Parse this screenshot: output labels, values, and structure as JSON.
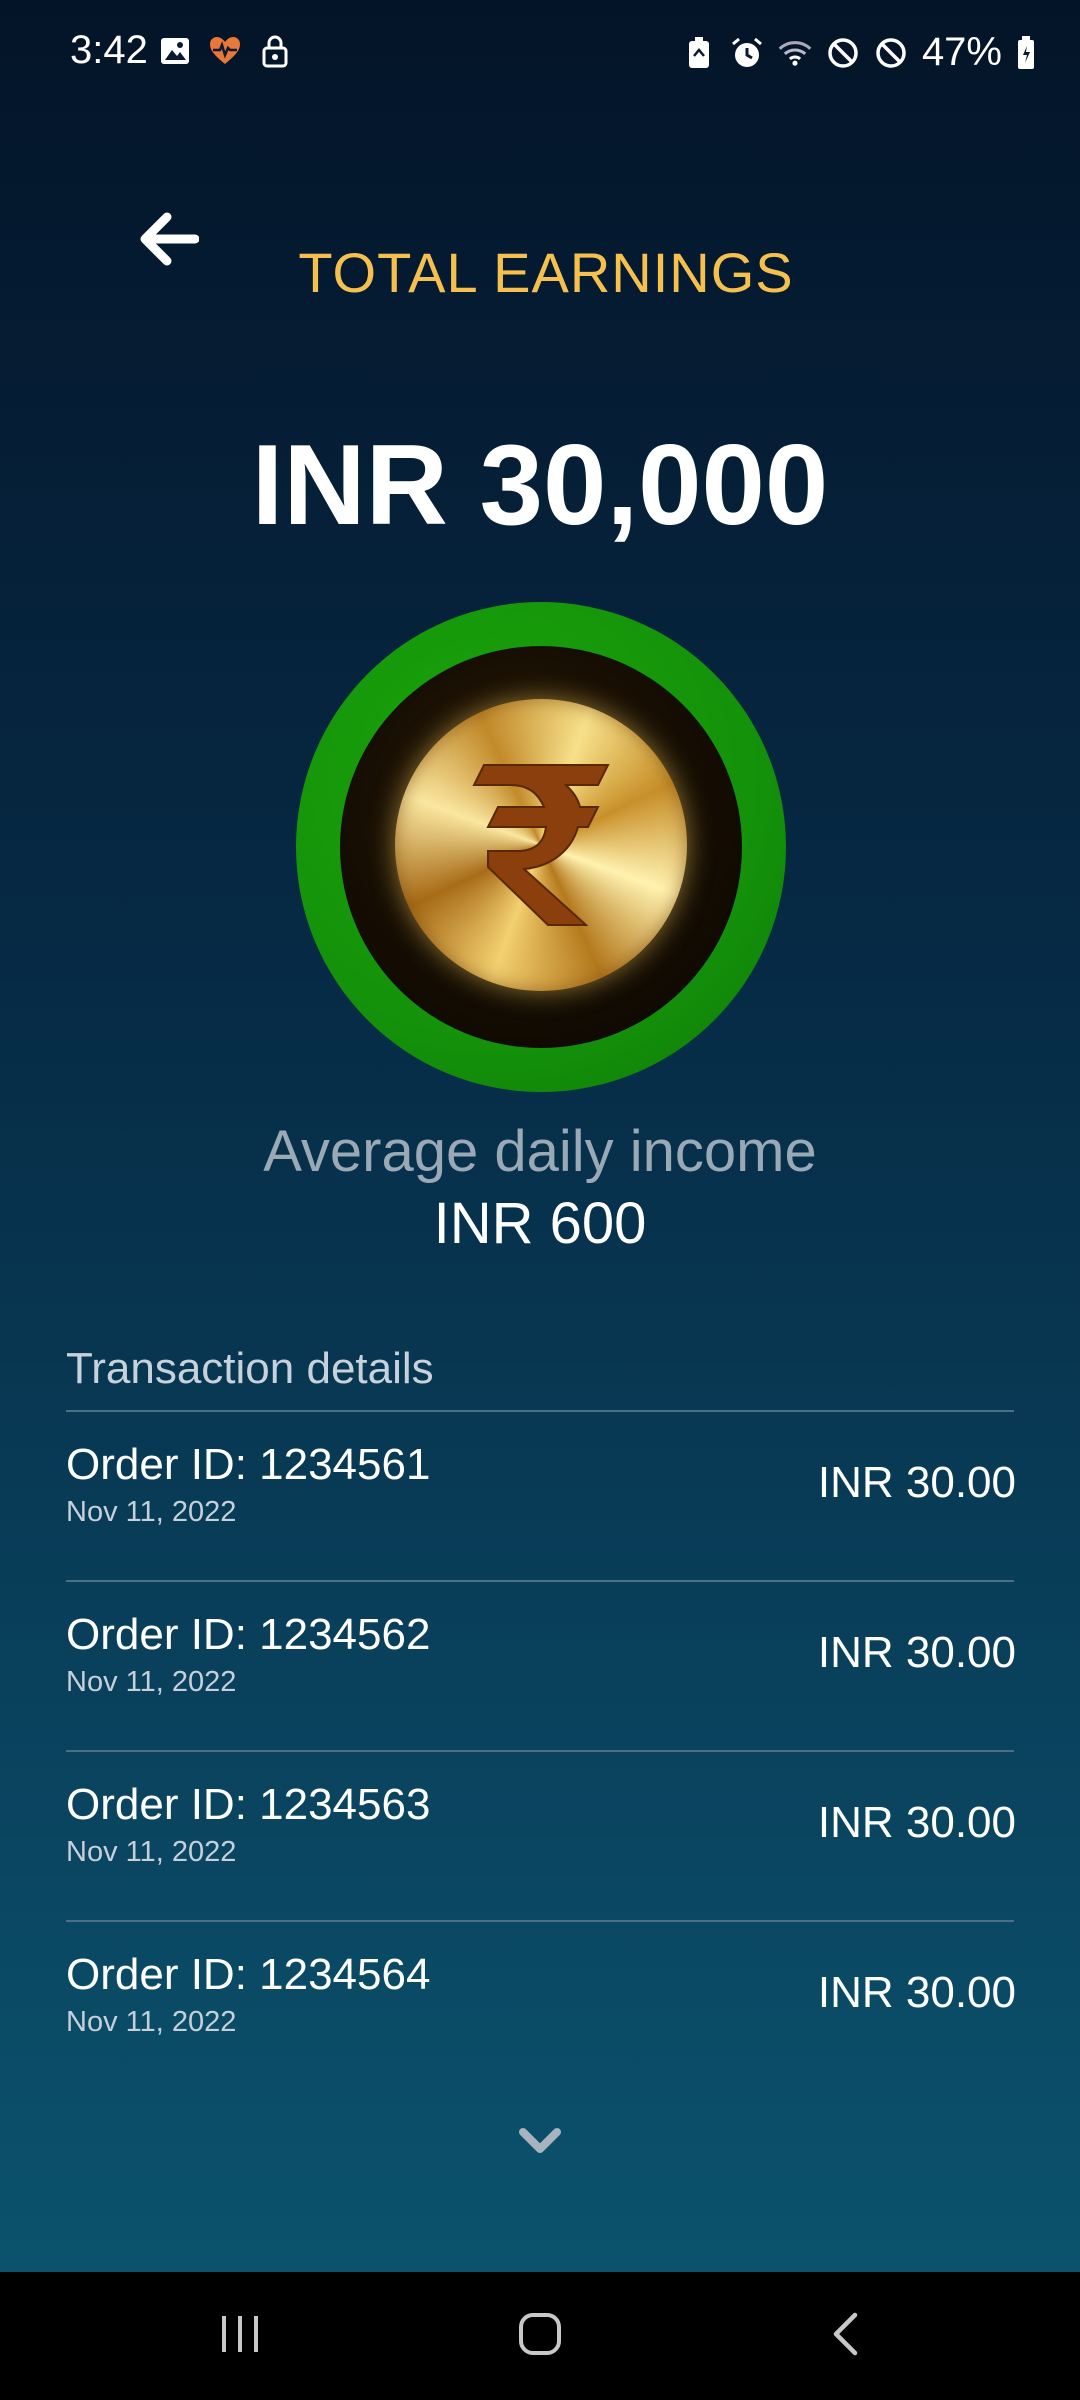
{
  "status_bar": {
    "time": "3:42",
    "battery_percent": "47%",
    "left_icons": [
      "image-icon",
      "health-icon",
      "lock-icon"
    ],
    "right_icons": [
      "battery-saver-icon",
      "alarm-icon",
      "wifi-icon",
      "do-not-disturb-icon",
      "blocked-icon",
      "battery-icon"
    ]
  },
  "header": {
    "title": "TOTAL EARNINGS",
    "back_icon": "arrow-left-icon"
  },
  "summary": {
    "total": "INR 30,000",
    "coin_icon": "rupee-coin-icon",
    "avg_label": "Average daily income",
    "avg_value": "INR 600"
  },
  "transactions": {
    "title": "Transaction details",
    "items": [
      {
        "order": "Order ID: 1234561",
        "date": "Nov 11, 2022",
        "amount": "INR 30.00"
      },
      {
        "order": "Order ID: 1234562",
        "date": "Nov 11, 2022",
        "amount": "INR 30.00"
      },
      {
        "order": "Order ID: 1234563",
        "date": "Nov 11, 2022",
        "amount": "INR 30.00"
      },
      {
        "order": "Order ID: 1234564",
        "date": "Nov 11, 2022",
        "amount": "INR 30.00"
      }
    ],
    "more_icon": "chevron-down-icon"
  },
  "colors": {
    "title": "#f5c04e",
    "ring": "#14920a",
    "background_top": "#041428",
    "background_bottom": "#0c5670"
  },
  "nav_bar": {
    "buttons": [
      "recent-apps-icon",
      "home-icon",
      "back-icon"
    ]
  }
}
